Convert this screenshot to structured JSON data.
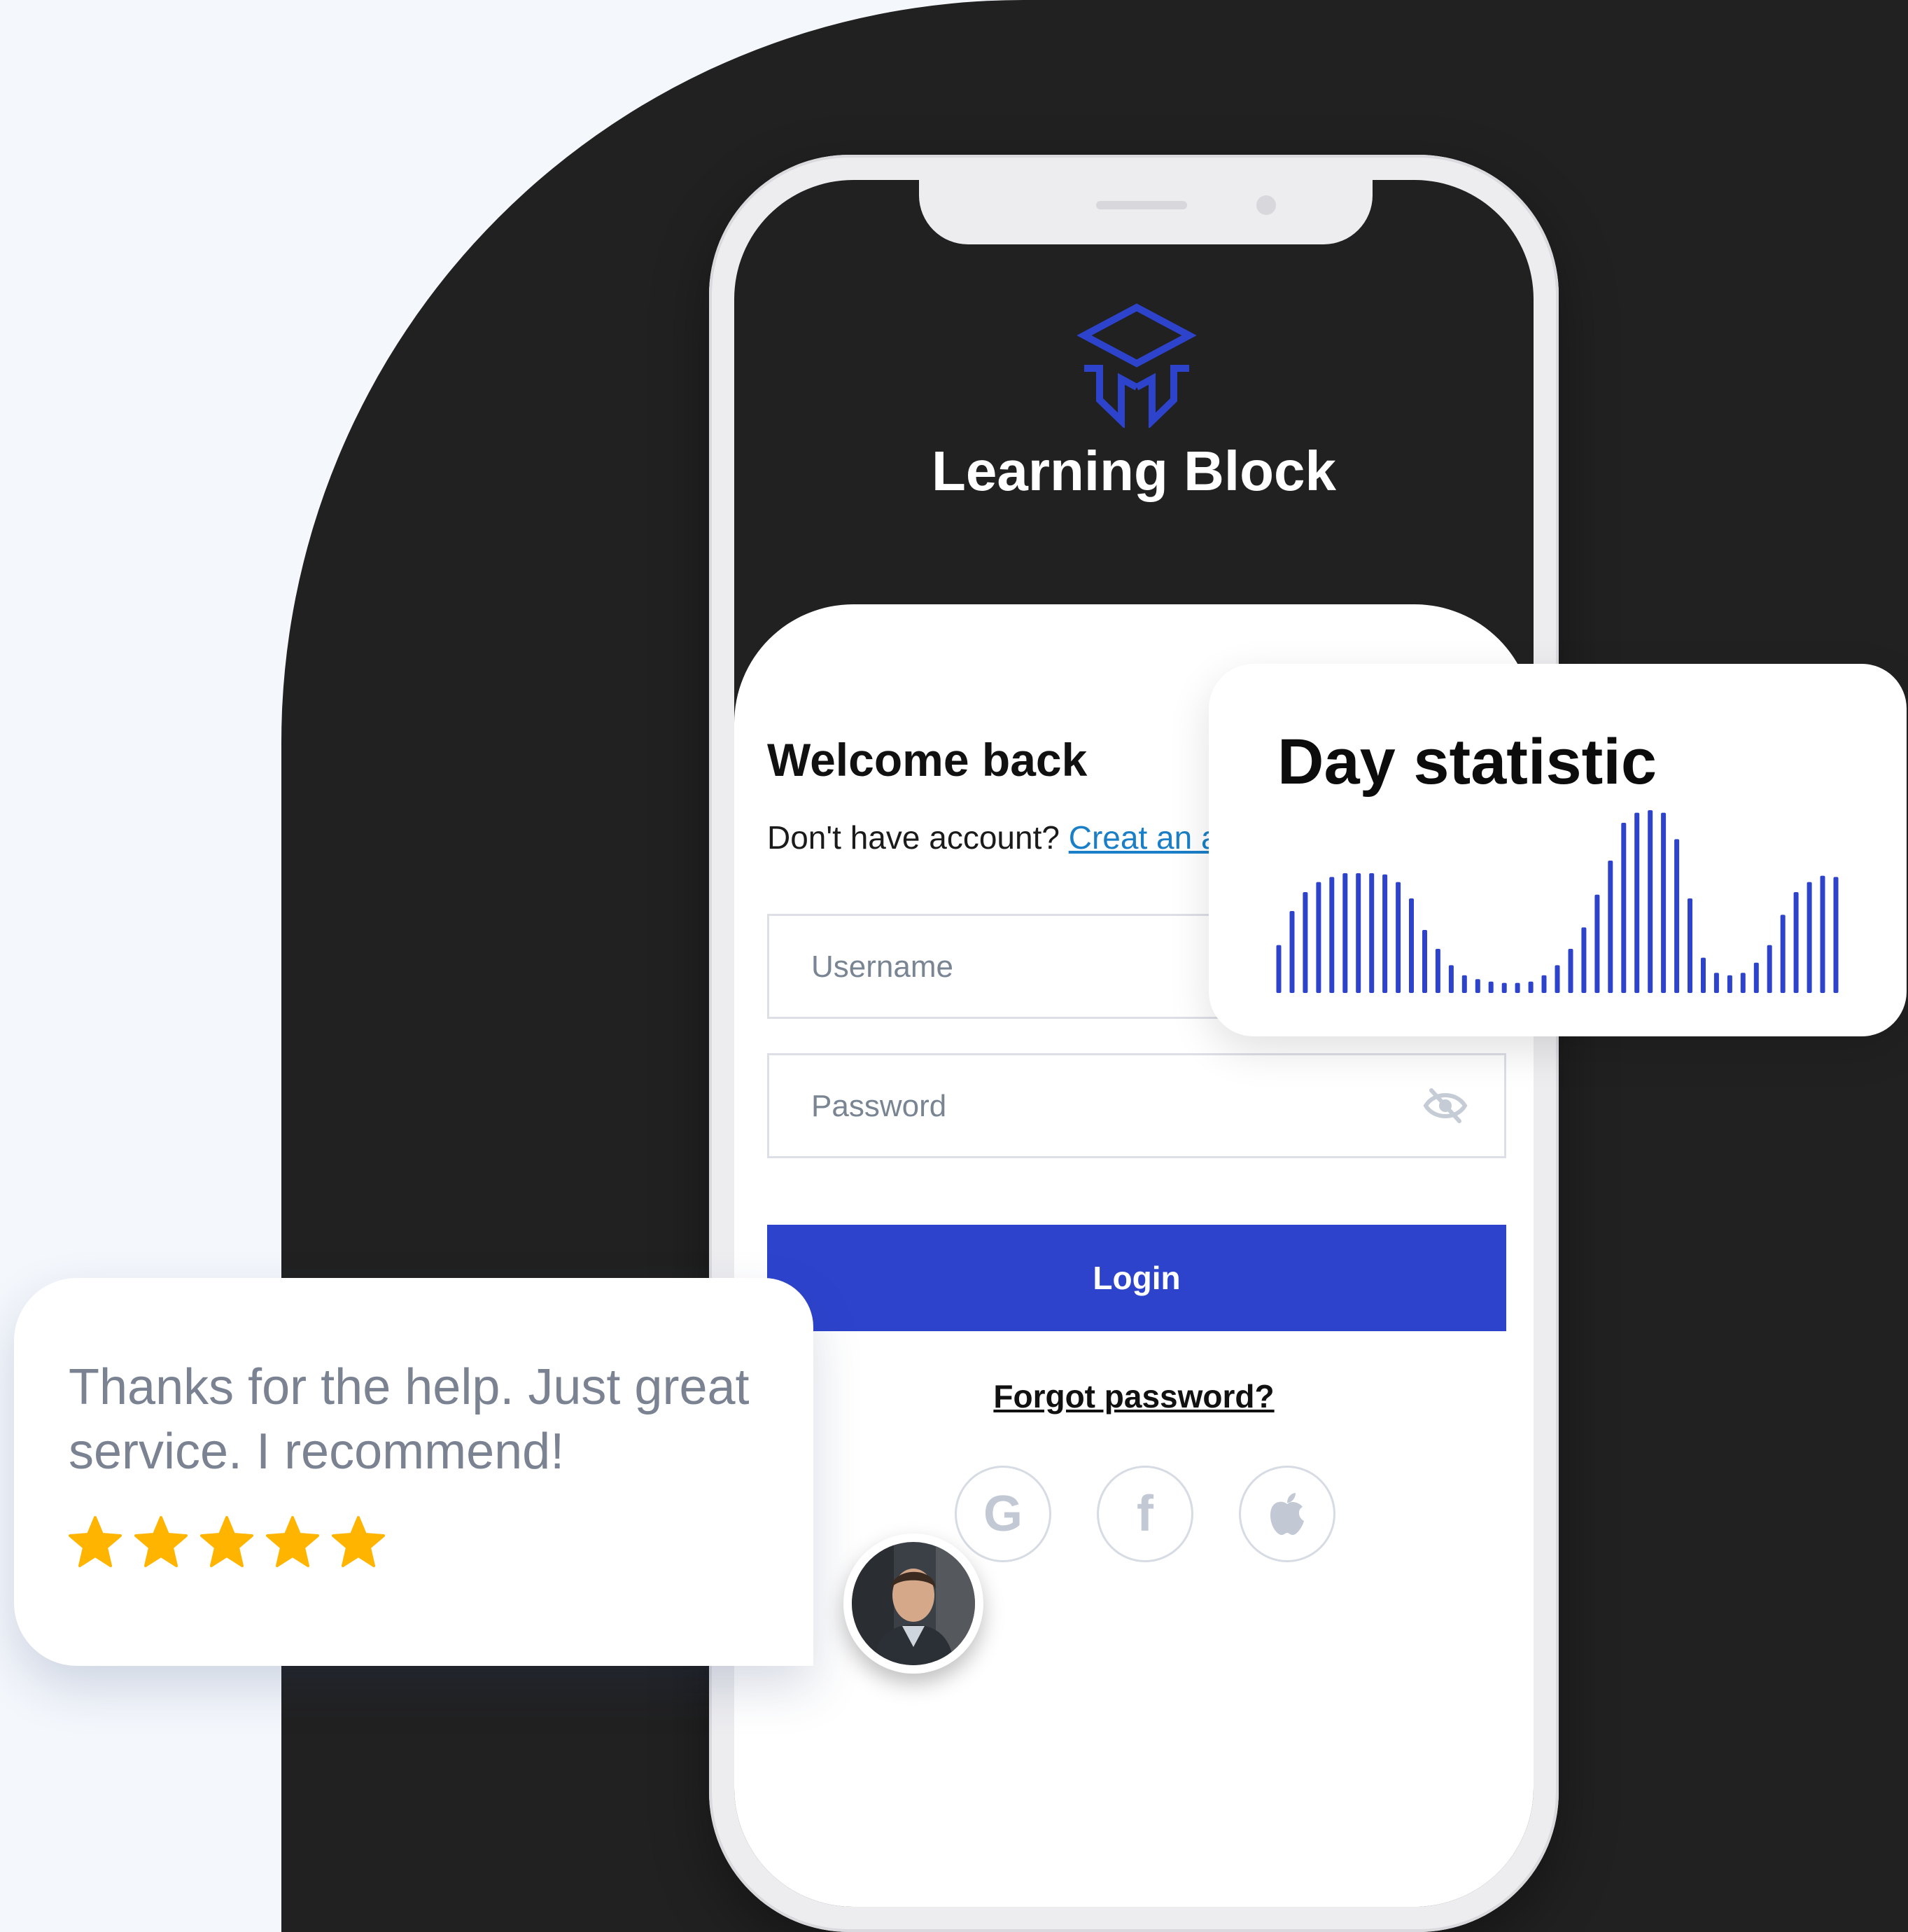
{
  "brand": {
    "name": "Learning Block",
    "accent_color": "#2d43cc"
  },
  "login": {
    "title": "Welcome back",
    "signup_prompt": "Don't have account?",
    "signup_link": "Creat an a",
    "username_placeholder": "Username",
    "password_placeholder": "Password",
    "login_label": "Login",
    "forgot_label": "Forgot password?",
    "social": [
      {
        "icon": "google-icon",
        "glyph": "G"
      },
      {
        "icon": "facebook-icon",
        "glyph": "f"
      },
      {
        "icon": "apple-icon",
        "glyph": ""
      }
    ]
  },
  "stat_card": {
    "title": "Day statistic",
    "bar_color": "#2d43cc"
  },
  "chart_data": {
    "type": "bar",
    "values": [
      38,
      65,
      80,
      88,
      92,
      95,
      95,
      95,
      94,
      88,
      75,
      50,
      35,
      22,
      14,
      11,
      9,
      8,
      8,
      9,
      14,
      22,
      35,
      52,
      78,
      105,
      135,
      143,
      145,
      143,
      122,
      75,
      28,
      16,
      14,
      16,
      24,
      38,
      62,
      80,
      88,
      93,
      92
    ],
    "ylim": [
      0,
      150
    ]
  },
  "review": {
    "text": "Thanks for the help. Just great service. I recommend!",
    "rating": 5,
    "star_color": "#ffb400"
  }
}
